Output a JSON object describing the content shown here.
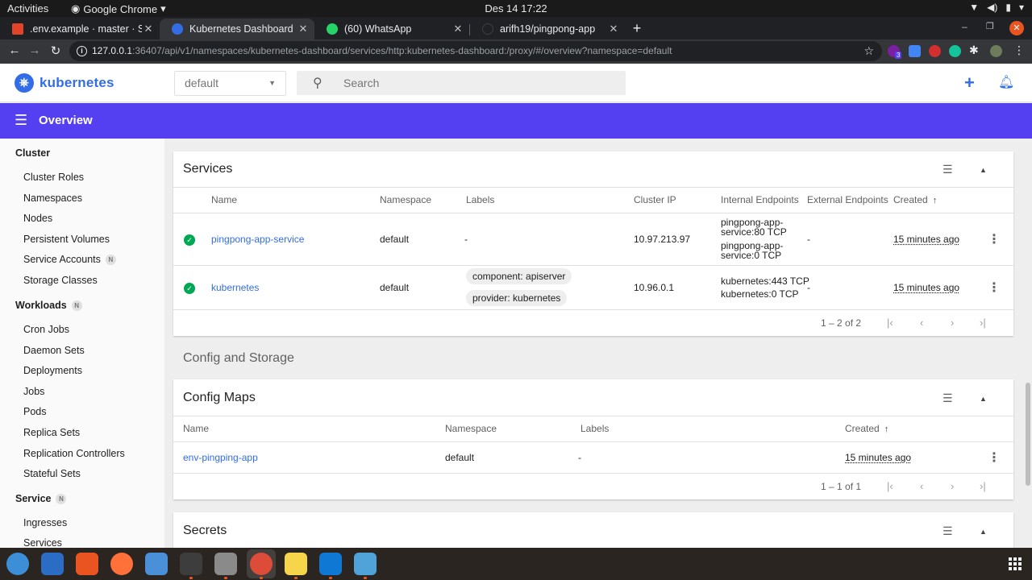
{
  "system": {
    "activities": "Activities",
    "app_name": "Google Chrome",
    "clock": "Des 14  17:22"
  },
  "browser": {
    "tabs": [
      {
        "title": ".env.example · master · Sa",
        "active": false
      },
      {
        "title": "Kubernetes Dashboard",
        "active": true
      },
      {
        "title": "(60) WhatsApp",
        "active": false
      },
      {
        "title": "arifh19/pingpong-app",
        "active": false
      }
    ],
    "url_host": "127.0.0.1",
    "url_path": ":36407/api/v1/namespaces/kubernetes-dashboard/services/http:kubernetes-dashboard:/proxy/#/overview?namespace=default",
    "extension_badge": "3"
  },
  "header": {
    "logo_text": "kubernetes",
    "namespace": "default",
    "search_placeholder": "Search"
  },
  "titlebar": {
    "title": "Overview"
  },
  "sidebar": {
    "cluster": {
      "label": "Cluster",
      "items": [
        "Cluster Roles",
        "Namespaces",
        "Nodes",
        "Persistent Volumes",
        "Service Accounts",
        "Storage Classes"
      ]
    },
    "workloads": {
      "label": "Workloads",
      "items": [
        "Cron Jobs",
        "Daemon Sets",
        "Deployments",
        "Jobs",
        "Pods",
        "Replica Sets",
        "Replication Controllers",
        "Stateful Sets"
      ]
    },
    "service": {
      "label": "Service",
      "items": [
        "Ingresses",
        "Services"
      ]
    },
    "namespace_badge": "N"
  },
  "services": {
    "title": "Services",
    "columns": [
      "Name",
      "Namespace",
      "Labels",
      "Cluster IP",
      "Internal Endpoints",
      "External Endpoints",
      "Created"
    ],
    "rows": [
      {
        "name": "pingpong-app-service",
        "namespace": "default",
        "labels": "-",
        "cluster_ip": "10.97.213.97",
        "internal_endpoints": [
          "pingpong-app-",
          "service:80 TCP",
          "pingpong-app-",
          "service:0 TCP"
        ],
        "external_endpoints": "-",
        "created": "15 minutes ago"
      },
      {
        "name": "kubernetes",
        "namespace": "default",
        "labels": [
          "component: apiserver",
          "provider: kubernetes"
        ],
        "cluster_ip": "10.96.0.1",
        "internal_endpoints": [
          "kubernetes:443 TCP",
          "kubernetes:0 TCP"
        ],
        "external_endpoints": "-",
        "created": "15 minutes ago"
      }
    ],
    "pagination": "1 – 2 of 2"
  },
  "config_storage": {
    "heading": "Config and Storage"
  },
  "config_maps": {
    "title": "Config Maps",
    "columns": [
      "Name",
      "Namespace",
      "Labels",
      "Created"
    ],
    "rows": [
      {
        "name": "env-pingping-app",
        "namespace": "default",
        "labels": "-",
        "created": "15 minutes ago"
      }
    ],
    "pagination": "1 – 1 of 1"
  },
  "secrets": {
    "title": "Secrets"
  },
  "colors": {
    "brand": "#326de6",
    "titlebar": "#5540f1",
    "status_ok": "#00a854",
    "gnome_accent": "#e95420"
  }
}
